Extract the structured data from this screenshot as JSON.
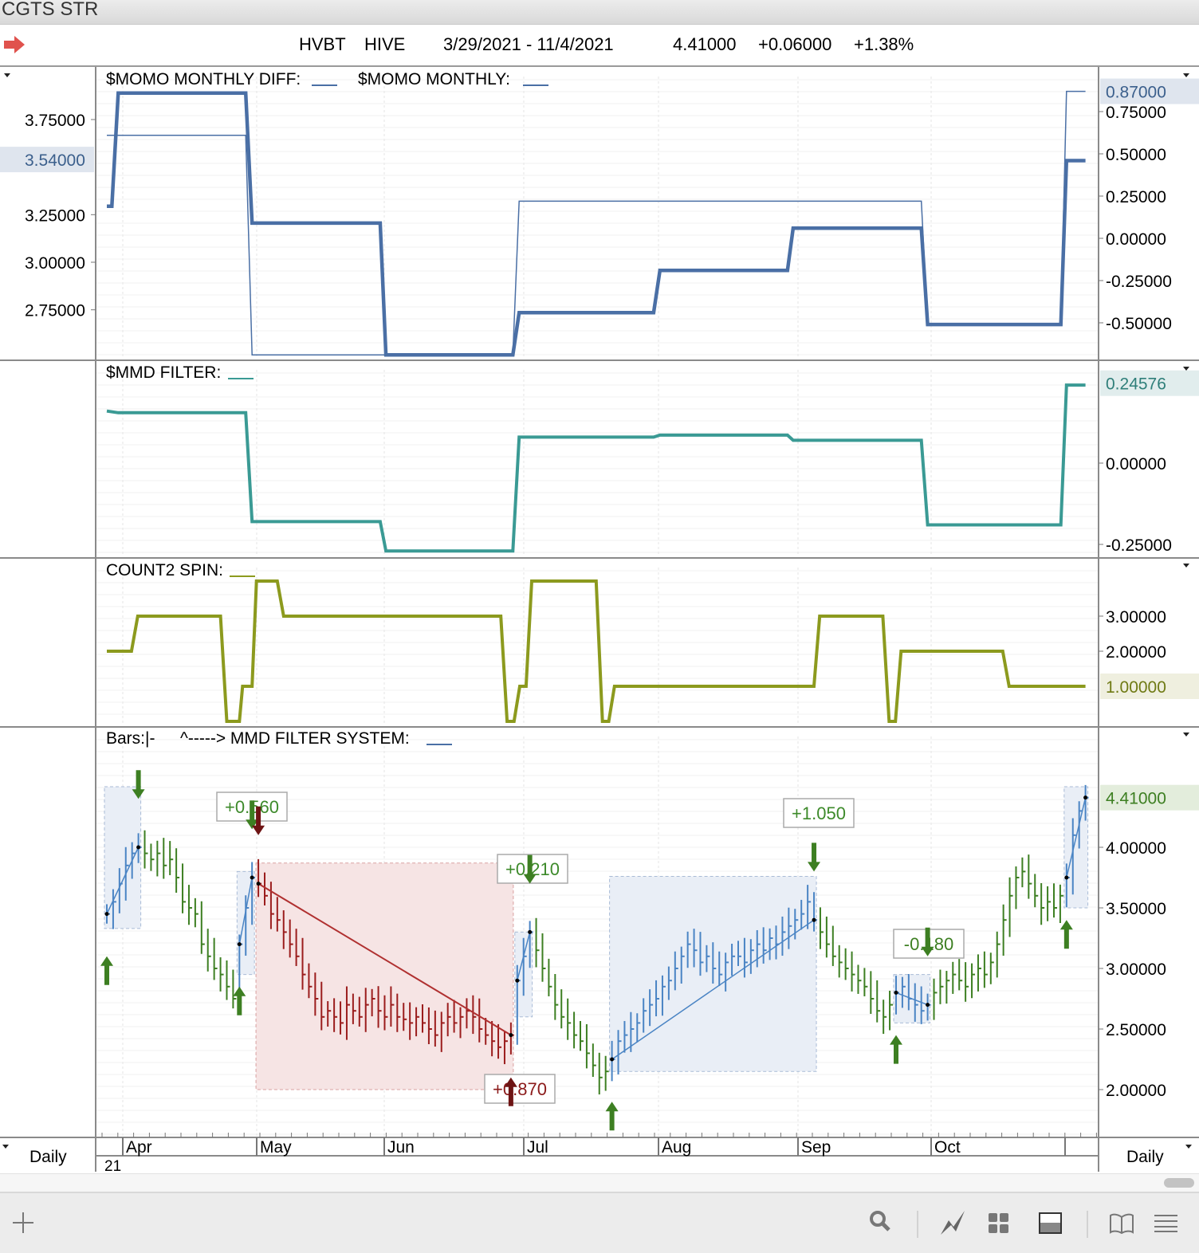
{
  "window": {
    "title": "CGTS STR"
  },
  "header": {
    "symbol": "HVBT",
    "exchange": "HIVE",
    "date_range": "3/29/2021 - 11/4/2021",
    "last": "4.41000",
    "change": "+0.06000",
    "change_pct": "+1.38%"
  },
  "colors": {
    "momo_diff": "#4a6fa5",
    "momo": "#4a6fa5",
    "mmd_filter": "#3a9a94",
    "count2": "#8c9a1e",
    "bar_up": "#3d7f22",
    "bar_short": "#9b1d1d",
    "trade_box_long": "#e9eef6",
    "trade_box_short": "#f6e4e4"
  },
  "time_axis": {
    "months": [
      "Apr",
      "May",
      "Jun",
      "Jul",
      "Aug",
      "Sep",
      "Oct"
    ],
    "year": "21",
    "period_left": "Daily",
    "period_right": "Daily"
  },
  "chart_data": [
    {
      "type": "line",
      "title": "$MOMO MONTHLY DIFF:___   $MOMO MONTHLY:___",
      "labels": [
        "$MOMO MONTHLY DIFF:",
        "$MOMO MONTHLY:"
      ],
      "x_unit": "bar index (0 = 3/29/2021)",
      "left_ticks": [
        "3.75000",
        "3.25000",
        "3.00000",
        "2.75000"
      ],
      "left_tick_values": [
        3.75,
        3.25,
        3.0,
        2.75
      ],
      "left_current": "3.54000",
      "left_current_value": 3.54,
      "right_ticks": [
        "0.75000",
        "0.50000",
        "0.25000",
        "0.00000",
        "-0.25000",
        "-0.50000"
      ],
      "right_tick_values": [
        0.75,
        0.5,
        0.25,
        0,
        -0.25,
        -0.5
      ],
      "right_current": "0.87000",
      "right_current_value": 0.87,
      "series": [
        {
          "name": "$MOMO MONTHLY DIFF",
          "width": "thick",
          "points": [
            [
              0,
              0.19
            ],
            [
              0.8,
              0.19
            ],
            [
              1.8,
              0.86
            ],
            [
              22,
              0.86
            ],
            [
              23,
              0.09
            ],
            [
              43.3,
              0.09
            ],
            [
              44.2,
              -0.69
            ],
            [
              64.3,
              -0.69
            ],
            [
              65.3,
              -0.44
            ],
            [
              86.6,
              -0.44
            ],
            [
              87.6,
              -0.19
            ],
            [
              107.8,
              -0.19
            ],
            [
              108.7,
              0.06
            ],
            [
              129,
              0.06
            ],
            [
              130,
              -0.51
            ],
            [
              151.1,
              -0.51
            ],
            [
              152,
              0.46
            ],
            [
              155,
              0.46
            ]
          ]
        },
        {
          "name": "$MOMO MONTHLY",
          "width": "thin",
          "points": [
            [
              0,
              0.61
            ],
            [
              22,
              0.61
            ],
            [
              23,
              -0.69
            ],
            [
              64.3,
              -0.69
            ],
            [
              65.3,
              0.22
            ],
            [
              129,
              0.22
            ],
            [
              130,
              -0.51
            ],
            [
              151.1,
              -0.51
            ],
            [
              152,
              0.87
            ],
            [
              155,
              0.87
            ]
          ]
        }
      ]
    },
    {
      "type": "line",
      "labels": [
        "$MMD FILTER:"
      ],
      "right_ticks": [
        "0.00000",
        "-0.25000"
      ],
      "right_tick_values": [
        0,
        -0.25
      ],
      "right_current": "0.24576",
      "right_current_value": 0.24576,
      "series": [
        {
          "name": "$MMD FILTER",
          "points": [
            [
              0,
              0.16
            ],
            [
              1.8,
              0.155
            ],
            [
              22,
              0.155
            ],
            [
              23,
              -0.18
            ],
            [
              43.3,
              -0.18
            ],
            [
              44.2,
              -0.27
            ],
            [
              64.3,
              -0.27
            ],
            [
              65.3,
              0.08
            ],
            [
              86.6,
              0.08
            ],
            [
              87.6,
              0.086
            ],
            [
              107.8,
              0.086
            ],
            [
              108.7,
              0.07
            ],
            [
              129,
              0.07
            ],
            [
              130,
              -0.19
            ],
            [
              151.1,
              -0.19
            ],
            [
              152,
              0.24
            ],
            [
              155,
              0.24
            ]
          ]
        }
      ]
    },
    {
      "type": "line",
      "labels": [
        "COUNT2 SPIN:"
      ],
      "right_ticks": [
        "3.00000",
        "2.00000"
      ],
      "right_tick_values": [
        3,
        2
      ],
      "right_current": "1.00000",
      "right_current_value": 1,
      "series": [
        {
          "name": "COUNT2 SPIN",
          "points": [
            [
              0,
              2
            ],
            [
              3.9,
              2
            ],
            [
              4.9,
              3
            ],
            [
              18,
              3
            ],
            [
              19,
              0
            ],
            [
              21,
              0
            ],
            [
              21.5,
              1
            ],
            [
              23,
              1
            ],
            [
              23.7,
              4
            ],
            [
              27,
              4
            ],
            [
              28,
              3
            ],
            [
              62.4,
              3
            ],
            [
              63.4,
              0
            ],
            [
              64.5,
              0
            ],
            [
              65.4,
              1
            ],
            [
              66.4,
              1
            ],
            [
              67.3,
              4
            ],
            [
              77.5,
              4
            ],
            [
              78.5,
              0
            ],
            [
              79.5,
              0
            ],
            [
              80.4,
              1
            ],
            [
              112,
              1
            ],
            [
              112.9,
              3
            ],
            [
              122.9,
              3
            ],
            [
              123.9,
              0
            ],
            [
              124.9,
              0
            ],
            [
              125.8,
              2
            ],
            [
              141.9,
              2
            ],
            [
              142.9,
              1
            ],
            [
              155,
              1
            ]
          ]
        }
      ]
    },
    {
      "type": "bar",
      "labels": [
        "Bars:|-",
        "^-----> MMD FILTER SYSTEM:"
      ],
      "right_ticks": [
        "4.00000",
        "3.50000",
        "3.00000",
        "2.50000",
        "2.00000"
      ],
      "right_tick_values": [
        4,
        3.5,
        3,
        2.5,
        2
      ],
      "right_current": "4.41000",
      "right_current_value": 4.41,
      "closes": [
        3.45,
        3.55,
        3.7,
        3.85,
        3.95,
        4.0,
        3.95,
        3.9,
        3.95,
        3.85,
        3.9,
        3.75,
        3.55,
        3.5,
        3.45,
        3.2,
        3.1,
        3.0,
        2.95,
        2.85,
        2.75,
        3.2,
        3.5,
        3.75,
        3.7,
        3.6,
        3.45,
        3.4,
        3.3,
        3.2,
        3.1,
        2.95,
        2.85,
        2.75,
        2.6,
        2.65,
        2.6,
        2.55,
        2.7,
        2.65,
        2.6,
        2.7,
        2.75,
        2.65,
        2.6,
        2.7,
        2.6,
        2.58,
        2.55,
        2.6,
        2.55,
        2.5,
        2.45,
        2.55,
        2.6,
        2.55,
        2.6,
        2.65,
        2.6,
        2.5,
        2.45,
        2.4,
        2.35,
        2.4,
        2.45,
        2.9,
        3.1,
        3.3,
        3.15,
        3.0,
        2.85,
        2.7,
        2.6,
        2.55,
        2.45,
        2.4,
        2.3,
        2.2,
        2.1,
        2.15,
        2.25,
        2.4,
        2.45,
        2.5,
        2.55,
        2.65,
        2.7,
        2.75,
        2.85,
        2.9,
        3.0,
        3.1,
        3.2,
        3.15,
        3.05,
        3.1,
        3.0,
        2.95,
        3.05,
        3.1,
        3.1,
        3.05,
        3.15,
        3.2,
        3.15,
        3.25,
        3.2,
        3.3,
        3.35,
        3.4,
        3.45,
        3.55,
        3.4,
        3.3,
        3.2,
        3.1,
        3.05,
        3.0,
        2.95,
        2.9,
        2.85,
        2.75,
        2.65,
        2.6,
        2.7,
        2.8,
        2.85,
        2.75,
        2.7,
        2.65,
        2.7,
        2.8,
        2.85,
        2.9,
        2.95,
        2.9,
        2.85,
        2.95,
        3.0,
        2.95,
        3.05,
        3.2,
        3.4,
        3.6,
        3.75,
        3.8,
        3.7,
        3.6,
        3.5,
        3.55,
        3.5,
        3.6,
        3.75,
        4.1,
        4.3,
        4.41
      ],
      "trades": [
        {
          "side": "long",
          "start": 0,
          "end": 5,
          "box": [
            3.33,
            4.5
          ],
          "label": ""
        },
        {
          "side": "long",
          "start": 21,
          "end": 23,
          "box": [
            2.95,
            3.8
          ],
          "label": "+0.560"
        },
        {
          "side": "short",
          "start": 24,
          "end": 64,
          "box": [
            2.0,
            3.87
          ],
          "label": "+0.870"
        },
        {
          "side": "long",
          "start": 65,
          "end": 67,
          "box": [
            2.6,
            3.3
          ],
          "label": "+0.210"
        },
        {
          "side": "long",
          "start": 80,
          "end": 112,
          "box": [
            2.15,
            3.76
          ],
          "label": "+1.050"
        },
        {
          "side": "long",
          "start": 125,
          "end": 130,
          "box": [
            2.55,
            2.95
          ],
          "label": "-0.180"
        },
        {
          "side": "long",
          "start": 152,
          "end": 155,
          "box": [
            3.5,
            4.5
          ],
          "label": ""
        }
      ],
      "signals": [
        {
          "bar": 0,
          "type": "buy"
        },
        {
          "bar": 5,
          "type": "sell"
        },
        {
          "bar": 21,
          "type": "buy"
        },
        {
          "bar": 23,
          "type": "sell"
        },
        {
          "bar": 24,
          "type": "short"
        },
        {
          "bar": 64,
          "type": "cover"
        },
        {
          "bar": 67,
          "type": "sell"
        },
        {
          "bar": 80,
          "type": "buy"
        },
        {
          "bar": 112,
          "type": "sell"
        },
        {
          "bar": 125,
          "type": "buy"
        },
        {
          "bar": 130,
          "type": "sell"
        },
        {
          "bar": 152,
          "type": "buy"
        }
      ]
    }
  ],
  "toolbar": {
    "icons": [
      "plus-icon",
      "search-icon",
      "chart-line-icon",
      "grid-icon",
      "panel-icon",
      "book-icon",
      "menu-icon"
    ]
  }
}
